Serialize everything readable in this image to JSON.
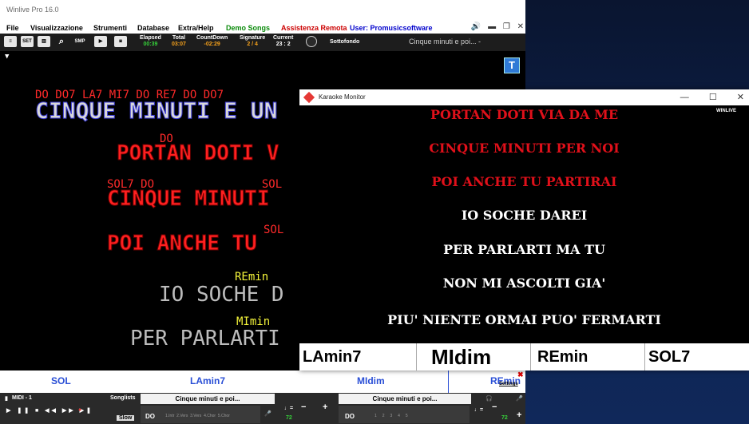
{
  "app": {
    "title": "Winlive Pro 16.0",
    "menu": [
      "File",
      "Visualizzazione",
      "Strumenti",
      "Database",
      "Extra/Help",
      "Demo Songs",
      "Assistenza Remota",
      "User: Promusicsoftware"
    ],
    "menu_colors": [
      "#000000",
      "#000000",
      "#000000",
      "#000000",
      "#000000",
      "#0a8a0a",
      "#cc0000",
      "#0000cc"
    ]
  },
  "toolbar": {
    "buttons": [
      "SET",
      "SMP"
    ],
    "stats": [
      {
        "label": "Elapsed",
        "value": "00:39",
        "color": "#36d23a"
      },
      {
        "label": "Total",
        "value": "03:07",
        "color": "#f7a21b"
      },
      {
        "label": "CountDown",
        "value": "-02:29",
        "color": "#f7a21b"
      },
      {
        "label": "Signature",
        "value": "2 / 4",
        "color": "#f7a21b"
      },
      {
        "label": "Current",
        "value": "23 : 2",
        "color": "#ffffff"
      }
    ],
    "background_label": "Sottofondo",
    "song_title": "Cinque minuti e poi... -"
  },
  "stage": {
    "toggle_label": "T",
    "lines": [
      {
        "chords": "DO DO7 LA7 MI7 DO RE7 DO DO7",
        "text": "CINQUE MINUTI E UN",
        "text_color": "#d8d8d8",
        "stroke": "#3b3bd6",
        "chord_color": "#ff2a2a"
      },
      {
        "chords": "DO",
        "text": "PORTAN DOTI V",
        "text_color": "#ff2020",
        "stroke": "#6a0000",
        "chord_color": "#ff2a2a"
      },
      {
        "chords": "SOL7 DO                SOL",
        "text": "CINQUE MINUTI",
        "text_color": "#ff2020",
        "stroke": "#6a0000",
        "chord_color": "#ff2a2a"
      },
      {
        "chords": "SOL",
        "text": "POI ANCHE TU",
        "text_color": "#ff2020",
        "stroke": "#6a0000",
        "chord_color": "#ff2a2a"
      },
      {
        "chords": "REmin",
        "text": "IO SOCHE D",
        "text_color": "#bcbcbc",
        "stroke": "",
        "chord_color": "#f4f43a"
      },
      {
        "chords": "MImin",
        "text": "PER PARLARTI",
        "text_color": "#bcbcbc",
        "stroke": "",
        "chord_color": "#f4f43a"
      }
    ]
  },
  "chord_strip": {
    "chords": [
      "SOL",
      "LAmin7",
      "MIdim",
      "REmin"
    ],
    "settings_label": "Settings"
  },
  "players": {
    "left": {
      "label": "MIDI - 1",
      "songlists": "Songlists",
      "song": "Cinque minuti e poi...",
      "section": "DO",
      "parts": "1.Intr  2.Vers  3.Vers  4.Chor  5.Chor",
      "speed": "Slow",
      "tempo": "72"
    },
    "right": {
      "song": "Cinque minuti e poi...",
      "section": "DO",
      "parts": "1     2     3     4     5",
      "tempo": "72"
    }
  },
  "karaoke_monitor": {
    "title": "Karaoke Monitor",
    "logo": "WINLIVE",
    "lines": [
      {
        "text": "PORTAN DOTI VIA DA ME",
        "color": "#e0101a"
      },
      {
        "text": "CINQUE MINUTI PER NOI",
        "color": "#e0101a"
      },
      {
        "text": "POI ANCHE TU PARTIRAI",
        "color": "#e0101a"
      },
      {
        "text": "IO SOCHE DAREI",
        "color": "#ffffff"
      },
      {
        "text": "PER PARLARTI MA TU",
        "color": "#ffffff"
      },
      {
        "text": "NON MI ASCOLTI GIA'",
        "color": "#ffffff"
      },
      {
        "text": "PIU' NIENTE ORMAI PUO' FERMARTI",
        "color": "#ffffff"
      }
    ],
    "chords": [
      "LAmin7",
      "MIdim",
      "REmin",
      "SOL7"
    ]
  }
}
